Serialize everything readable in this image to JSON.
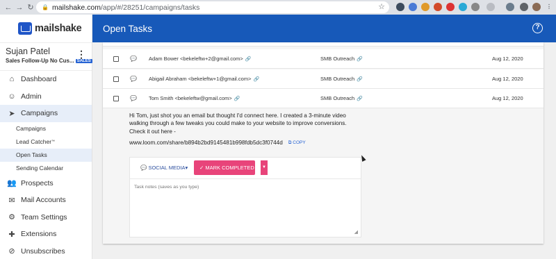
{
  "browser": {
    "url_host": "mailshake.com",
    "url_path": "/app/#/28251/campaigns/tasks"
  },
  "app": {
    "logo": "mailshake",
    "page_title": "Open Tasks",
    "help": "?"
  },
  "user": {
    "name": "Sujan Patel",
    "campaign": "Sales Follow-Up No Cus...",
    "badge": "SALES"
  },
  "sidebar": {
    "dashboard": "Dashboard",
    "admin": "Admin",
    "campaigns": "Campaigns",
    "sub": {
      "campaigns": "Campaigns",
      "lead_catcher": "Lead Catcher",
      "lead_catcher_mark": "™",
      "open_tasks": "Open Tasks",
      "sending_calendar": "Sending Calendar"
    },
    "prospects": "Prospects",
    "mail_accounts": "Mail Accounts",
    "team_settings": "Team Settings",
    "extensions": "Extensions",
    "unsubscribes": "Unsubscribes"
  },
  "tasks": [
    {
      "contact": "Adam Bower <bekeleftw+2@gmail.com>",
      "campaign": "SMB Outreach",
      "date": "Aug 12, 2020"
    },
    {
      "contact": "Abigail Abraham <bekeleftw+1@gmail.com>",
      "campaign": "SMB Outreach",
      "date": "Aug 12, 2020"
    },
    {
      "contact": "Tom Smith <bekeleftw@gmail.com>",
      "campaign": "SMB Outreach",
      "date": "Aug 12, 2020"
    }
  ],
  "detail": {
    "message": "Hi Tom, just shot you an email but thought I'd connect here. I created a 3-minute video walking through a few tweaks you could make to your website to improve conversions. Check it out here -",
    "url": "www.loom.com/share/b894b2bd9145481b998fdb5dc3f0744d",
    "copy_label": "COPY",
    "social_label": "SOCIAL MEDIA",
    "mark_completed_label": "MARK COMPLETED",
    "notes_placeholder": "Task notes (saves as you type)"
  }
}
